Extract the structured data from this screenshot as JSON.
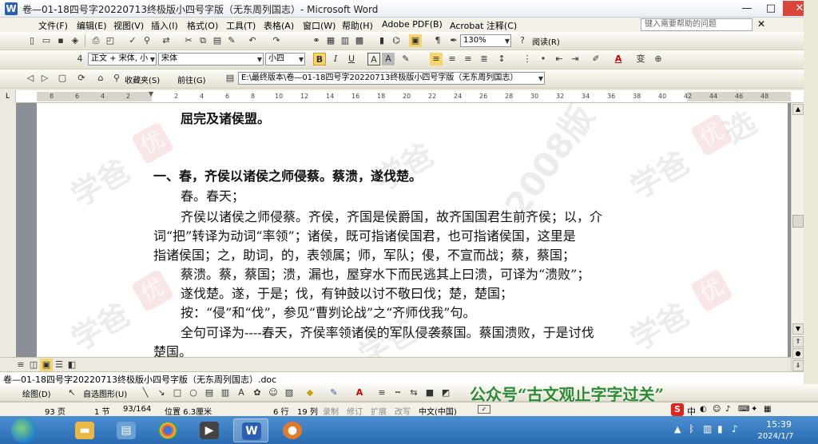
{
  "window": {
    "title": "卷—01-18四号字20220713终极版小四号字版（无东周列国志）- Microsoft Word",
    "app_icon": "W",
    "controls": {
      "minimize": "—",
      "maximize": "□",
      "close": "✕"
    }
  },
  "menu": {
    "items": [
      "文件(F)",
      "编辑(E)",
      "视图(V)",
      "插入(I)",
      "格式(O)",
      "工具(T)",
      "表格(A)",
      "窗口(W)",
      "帮助(H)",
      "Adobe PDF(B)",
      "Acrobat 注释(C)"
    ],
    "help_placeholder": "键入需要帮助的问题",
    "doc_close": "✕"
  },
  "standard_toolbar": {
    "zoom": "130%",
    "read_button": "阅读(R)"
  },
  "format_toolbar": {
    "style": "正文 + 宋体, 小",
    "font": "宋体",
    "size": "小四",
    "bold": "B",
    "italic": "I",
    "underline": "U",
    "char_border": "A",
    "char_shading": "A"
  },
  "web_toolbar": {
    "favorites": "收藏夹(S)",
    "goto": "前往(G)",
    "address": "E:\\最终版本\\卷—01-18四号字20220713终极版小四号字版（无东周列国志）"
  },
  "ruler": {
    "labels": [
      "8",
      "6",
      "4",
      "2",
      "2",
      "4",
      "6",
      "8",
      "10",
      "12",
      "14",
      "16",
      "18",
      "20",
      "22",
      "24",
      "26",
      "28",
      "30",
      "32",
      "34",
      "36",
      "38",
      "40",
      "42",
      "44",
      "46",
      "48"
    ]
  },
  "document": {
    "lines": [
      {
        "text": "屈完及诸侯盟。",
        "bold": true
      },
      {
        "text": "一、春，齐侯以诸侯之师侵蔡。蔡溃，遂伐楚。",
        "bold": true
      },
      {
        "text": "春。春天；",
        "bold": false
      },
      {
        "text": "齐侯以诸侯之师侵蔡。齐侯，齐国是侯爵国，故齐国国君生前齐侯；以，介",
        "bold": false
      },
      {
        "text": "词“把”转译为动词“率领”；诸侯，既可指诸侯国君，也可指诸侯国，这里是",
        "bold": false
      },
      {
        "text": "指诸侯国；之，助词，的，表领属；师，军队；侵，不宣而战；蔡，蔡国；",
        "bold": false
      },
      {
        "text": "蔡溃。蔡，蔡国；溃，漏也，屋穿水下而民逃其上曰溃，可译为“溃败”；",
        "bold": false
      },
      {
        "text": "遂伐楚。遂，于是；伐，有钟鼓以讨不敬曰伐；楚，楚国；",
        "bold": false
      },
      {
        "text": "按：“侵”和“伐”，参见“曹刿论战”之“齐师伐我”句。",
        "bold": false
      },
      {
        "text": "全句可译为----春天，齐侯率领诸侯的军队侵袭蔡国。蔡国溃败，于是讨伐",
        "bold": false
      },
      {
        "text": "楚国。",
        "bold": false
      }
    ],
    "watermark": [
      "学爸",
      "优",
      "选",
      "2008版"
    ]
  },
  "doc_tab": "卷—01-18四号字20220713终极版小四号字版（无东周列国志）.doc",
  "drawing_toolbar": {
    "draw": "绘图(D)",
    "autoshapes": "自选图形(U)"
  },
  "overlay_text": "公众号“古文观止字字过关”",
  "status": {
    "page": "93 页",
    "section": "1 节",
    "pages": "93/164",
    "position": "位置 6.3厘米",
    "line": "6 行",
    "column": "19 列",
    "rec": "录制",
    "trk": "修订",
    "ext": "扩展",
    "ovr": "改写",
    "lang": "中文(中国)"
  },
  "taskbar": {
    "time": "15:39",
    "date": "2024/1/7",
    "ime": "中"
  },
  "colors": {
    "accent": "#2b5fb4",
    "close": "#d9473a",
    "overlay_green": "#2c8a35",
    "taskbar": "#2a6bb2"
  }
}
